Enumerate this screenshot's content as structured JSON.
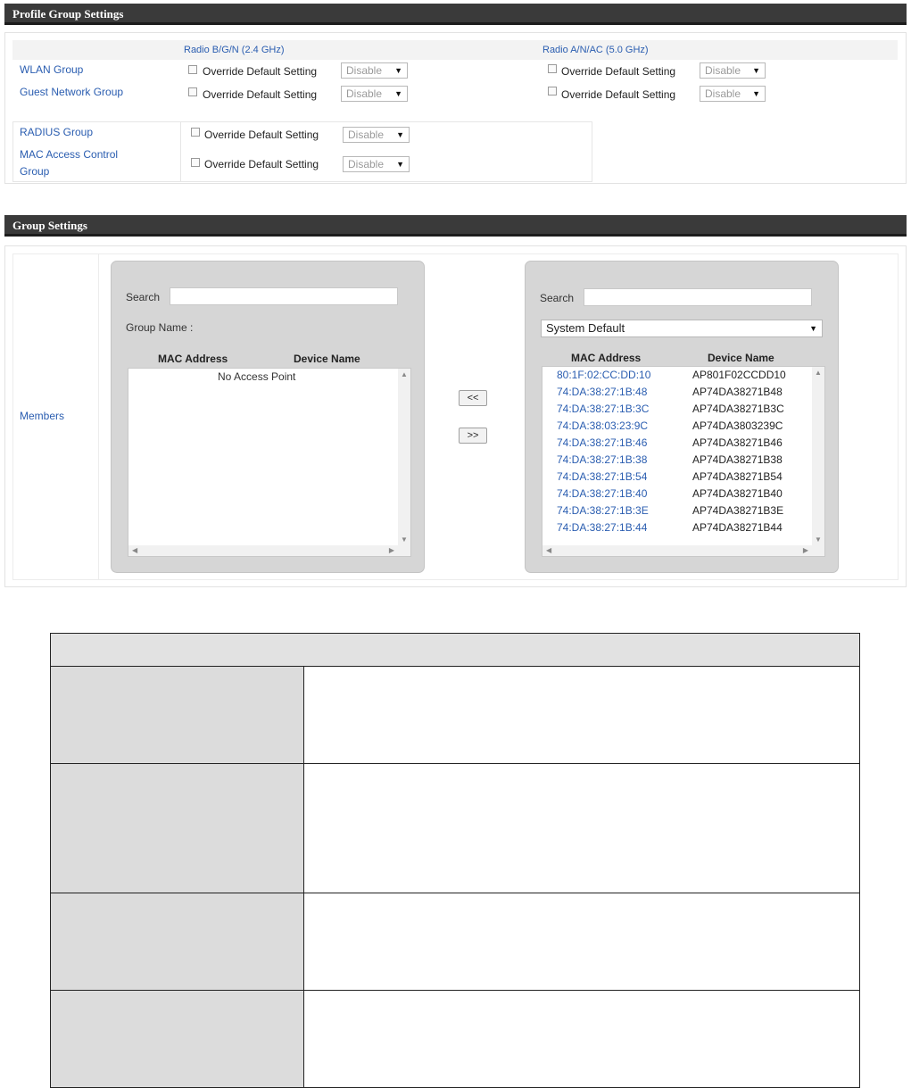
{
  "profile_group": {
    "title": "Profile Group Settings",
    "col_24": "Radio B/G/N (2.4 GHz)",
    "col_5": "Radio A/N/AC (5.0 GHz)",
    "override_label": "Override Default Setting",
    "select_value": "Disable",
    "rows": {
      "wlan": "WLAN Group",
      "guest": "Guest Network Group",
      "radius": "RADIUS Group",
      "mac_line1": "MAC Access Control",
      "mac_line2": "Group"
    }
  },
  "group_settings": {
    "title": "Group Settings",
    "members_label": "Members",
    "left": {
      "search_label": "Search",
      "group_name_label": "Group Name :",
      "col_mac": "MAC Address",
      "col_device": "Device Name",
      "empty_text": "No Access Point"
    },
    "move_left": "<<",
    "move_right": ">>",
    "right": {
      "search_label": "Search",
      "dropdown_value": "System Default",
      "col_mac": "MAC Address",
      "col_device": "Device Name",
      "rows": [
        {
          "mac": "80:1F:02:CC:DD:10",
          "device": "AP801F02CCDD10"
        },
        {
          "mac": "74:DA:38:27:1B:48",
          "device": "AP74DA38271B48"
        },
        {
          "mac": "74:DA:38:27:1B:3C",
          "device": "AP74DA38271B3C"
        },
        {
          "mac": "74:DA:38:03:23:9C",
          "device": "AP74DA3803239C"
        },
        {
          "mac": "74:DA:38:27:1B:46",
          "device": "AP74DA38271B46"
        },
        {
          "mac": "74:DA:38:27:1B:38",
          "device": "AP74DA38271B38"
        },
        {
          "mac": "74:DA:38:27:1B:54",
          "device": "AP74DA38271B54"
        },
        {
          "mac": "74:DA:38:27:1B:40",
          "device": "AP74DA38271B40"
        },
        {
          "mac": "74:DA:38:27:1B:3E",
          "device": "AP74DA38271B3E"
        },
        {
          "mac": "74:DA:38:27:1B:44",
          "device": "AP74DA38271B44"
        }
      ]
    }
  },
  "icons": {
    "dropdown": "triangle-down-icon",
    "scroll_up": "scroll-up-arrow-icon",
    "scroll_down": "scroll-down-arrow-icon",
    "scroll_left": "scroll-left-arrow-icon",
    "scroll_right": "scroll-right-arrow-icon"
  },
  "colors": {
    "header_bar": "#3a3a3a",
    "link_blue": "#2a5db0",
    "member_box": "#d6d6d6"
  }
}
